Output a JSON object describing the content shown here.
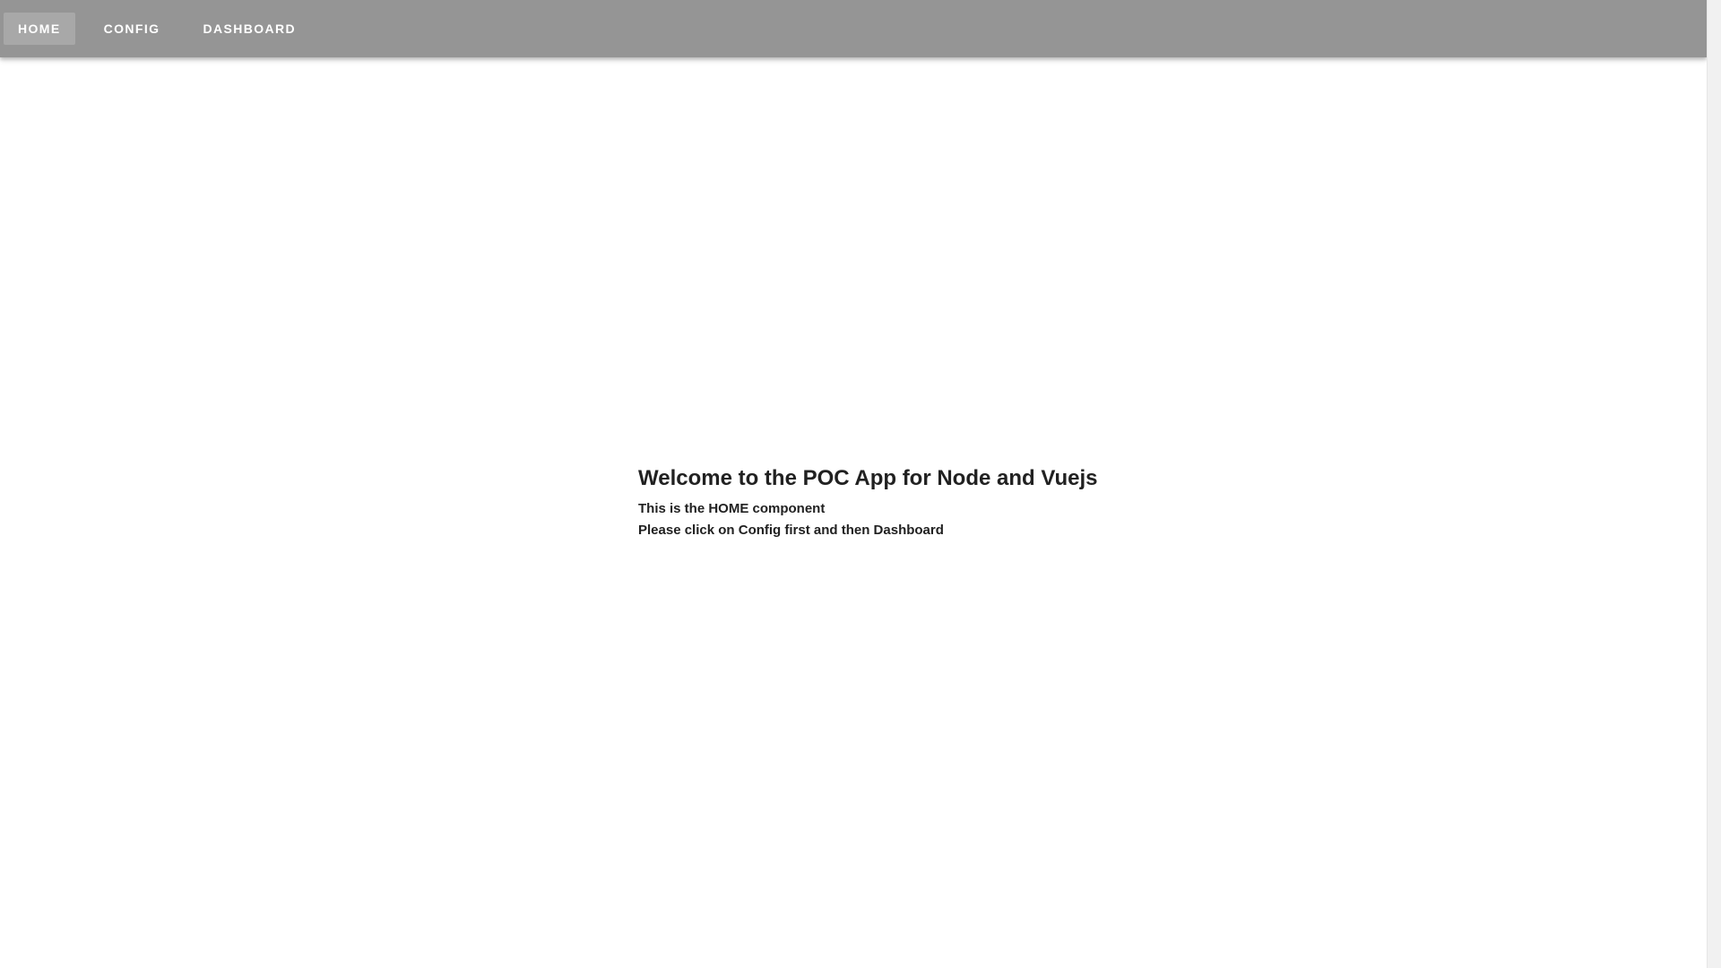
{
  "toolbar": {
    "background": "#959595",
    "items": [
      {
        "label": "HOME",
        "active": true
      },
      {
        "label": "CONFIG",
        "active": false
      },
      {
        "label": "DASHBOARD",
        "active": false
      }
    ]
  },
  "main": {
    "title": "Welcome to the POC App for Node and Vuejs",
    "line1": "This is the HOME component",
    "line2": "Please click on Config first and then Dashboard"
  }
}
